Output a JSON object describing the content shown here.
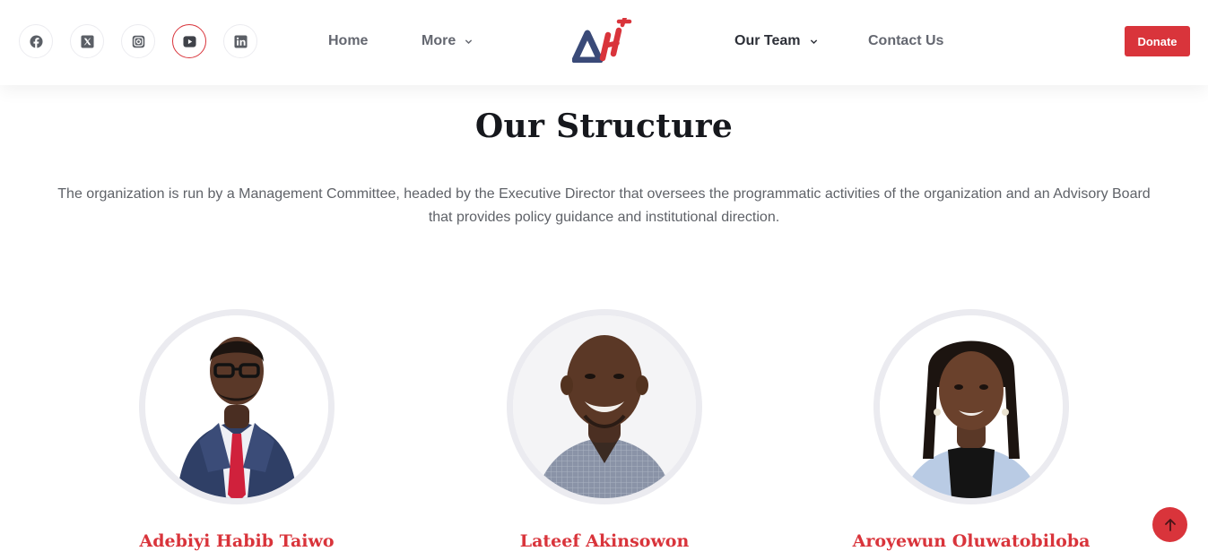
{
  "header": {
    "socials": [
      {
        "icon": "facebook-icon"
      },
      {
        "icon": "x-twitter-icon"
      },
      {
        "icon": "instagram-icon"
      },
      {
        "icon": "youtube-icon"
      },
      {
        "icon": "linkedin-icon"
      }
    ],
    "nav": {
      "home": "Home",
      "more": "More",
      "our_team": "Our Team",
      "contact": "Contact Us"
    },
    "logo_text": "AH",
    "donate_label": "Donate"
  },
  "main": {
    "title": "Our Structure",
    "intro": "The organization is run by a Management Committee, headed by the Executive Director that oversees the programmatic activities of the organization and an Advisory Board that provides policy guidance and institutional direction.",
    "members": [
      {
        "name": "Adebiyi Habib Taiwo"
      },
      {
        "name": "Lateef Akinsowon"
      },
      {
        "name": "Aroyewun Oluwatobiloba"
      }
    ]
  },
  "colors": {
    "brand_red": "#d9343b",
    "brand_navy": "#3a4a78",
    "text_dark": "#16181d",
    "text_body": "#5f6268",
    "avatar_ring": "#ebebf0"
  },
  "back_to_top_icon": "arrow-up-icon"
}
